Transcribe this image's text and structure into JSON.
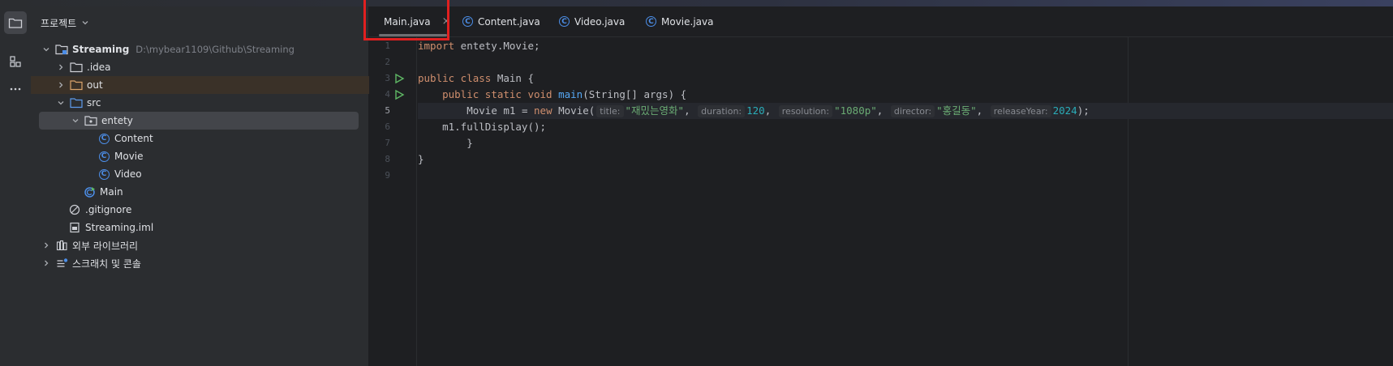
{
  "project_panel": {
    "title": "프로젝트",
    "tree": [
      {
        "label": "Streaming",
        "path": "D:\\mybear1109\\Github\\Streaming",
        "icon": "module-folder-icon",
        "expanded": true
      },
      {
        "label": ".idea",
        "icon": "folder-icon",
        "expanded": false
      },
      {
        "label": "out",
        "icon": "folder-icon",
        "expanded": false
      },
      {
        "label": "src",
        "icon": "folder-icon",
        "expanded": true
      },
      {
        "label": "entety",
        "icon": "package-icon",
        "expanded": true
      },
      {
        "label": "Content",
        "icon": "class-icon"
      },
      {
        "label": "Movie",
        "icon": "class-icon"
      },
      {
        "label": "Video",
        "icon": "class-icon"
      },
      {
        "label": "Main",
        "icon": "main-class-icon"
      },
      {
        "label": ".gitignore",
        "icon": "ignore-file-icon"
      },
      {
        "label": "Streaming.iml",
        "icon": "iml-file-icon"
      },
      {
        "label": "외부 라이브러리",
        "icon": "library-icon",
        "expanded": false
      },
      {
        "label": "스크래치 및 콘솔",
        "icon": "scratch-icon",
        "expanded": false
      }
    ]
  },
  "tabs": [
    {
      "label": "Main.java",
      "active": true,
      "close": "×"
    },
    {
      "label": "Content.java"
    },
    {
      "label": "Video.java"
    },
    {
      "label": "Movie.java"
    }
  ],
  "editor": {
    "line_numbers": [
      "1",
      "2",
      "3",
      "4",
      "5",
      "6",
      "7",
      "8",
      "9"
    ],
    "current_line": "5",
    "code": {
      "l1_kw": "import",
      "l1_rest": " entety.Movie;",
      "l3_kw": "public class",
      "l3_rest": " Main {",
      "l4_indent": "    ",
      "l4_kw": "public static void",
      "l4_fn": " main",
      "l4_rest": "(String[] args) {",
      "l5_indent": "        ",
      "l5_start": "Movie m1 = ",
      "l5_kw": "new",
      "l5_call": " Movie(",
      "hint_title": "title:",
      "arg_title": "\"재밌는영화\"",
      "hint_duration": "duration:",
      "arg_duration": "120",
      "hint_resolution": "resolution:",
      "arg_resolution": "\"1080p\"",
      "hint_director": "director:",
      "arg_director": "\"홍길동\"",
      "hint_releaseYear": "releaseYear:",
      "arg_releaseYear": "2024",
      "sep": ", ",
      "l5_end": ");",
      "l6": "    m1.fullDisplay();",
      "l7": "        }",
      "l8": "}"
    }
  },
  "colors": {
    "highlight_box": "#e02020",
    "keyword": "#cf8e6d",
    "string": "#6aab73",
    "number": "#2aacb8",
    "function": "#56a8f5"
  }
}
